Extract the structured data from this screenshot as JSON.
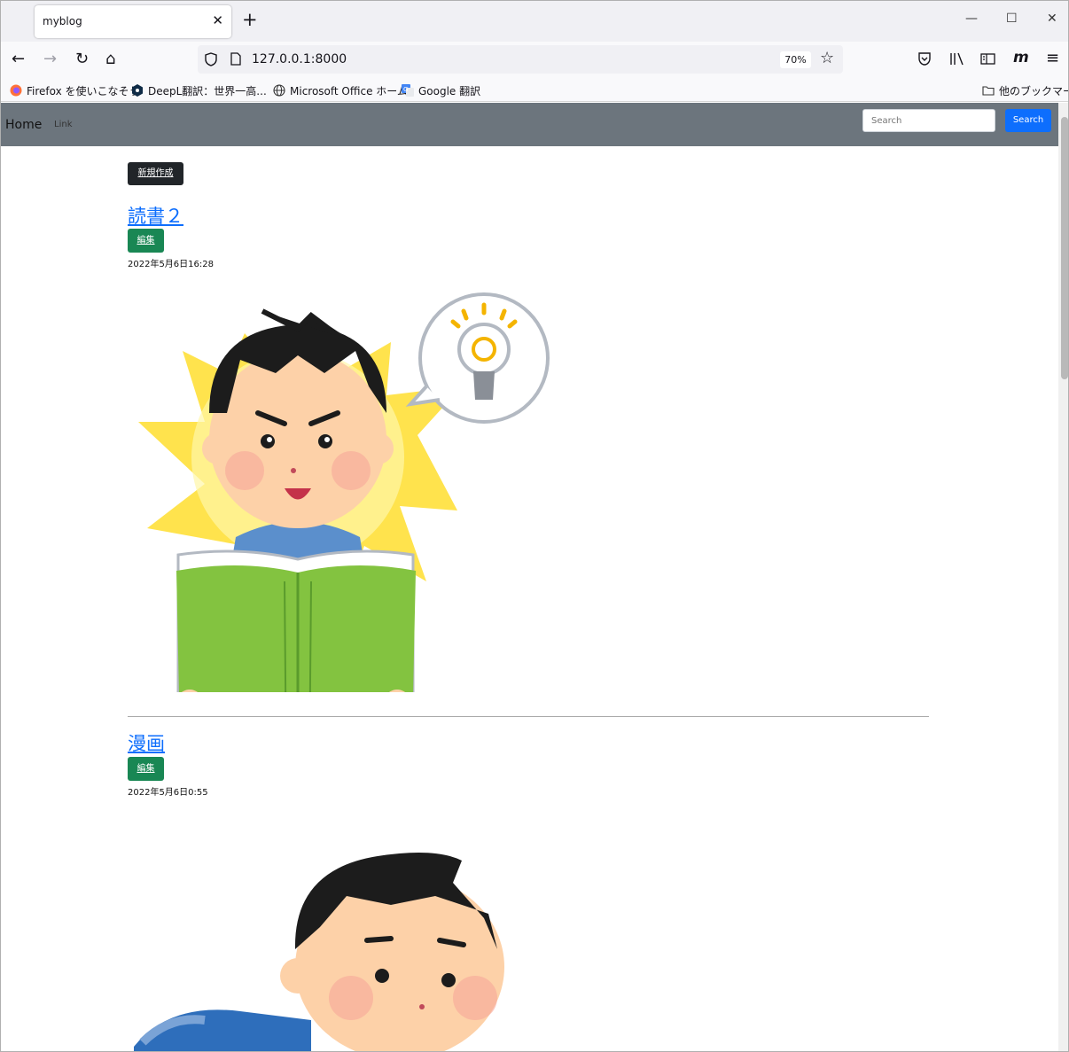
{
  "tab": {
    "title": "myblog"
  },
  "toolbar": {
    "url": "127.0.0.1:8000",
    "zoom": "70%"
  },
  "bookmarks": [
    {
      "label": "Firefox を使いこなそう",
      "icon": "firefox-icon"
    },
    {
      "label": "DeepL翻訳：世界一高...",
      "icon": "deepl-icon"
    },
    {
      "label": "Microsoft Office ホーム",
      "icon": "globe-icon"
    },
    {
      "label": "Google 翻訳",
      "icon": "google-translate-icon"
    },
    {
      "label": "他のブックマーク",
      "icon": "folder-icon"
    }
  ],
  "navbar": {
    "home": "Home",
    "link": "Link",
    "search_placeholder": "Search",
    "search_button": "Search"
  },
  "page": {
    "new_button": "新規作成"
  },
  "posts": [
    {
      "title": "読書２",
      "edit_label": "編集",
      "date": "2022年5月6日16:28",
      "image": "boy-reading-book-idea"
    },
    {
      "title": "漫画",
      "edit_label": "編集",
      "date": "2022年5月6日0:55",
      "image": "boy-lying-reading"
    }
  ],
  "colors": {
    "navbar": "#6c757d",
    "link": "#0d6efd",
    "edit": "#198754",
    "new": "#212529"
  }
}
